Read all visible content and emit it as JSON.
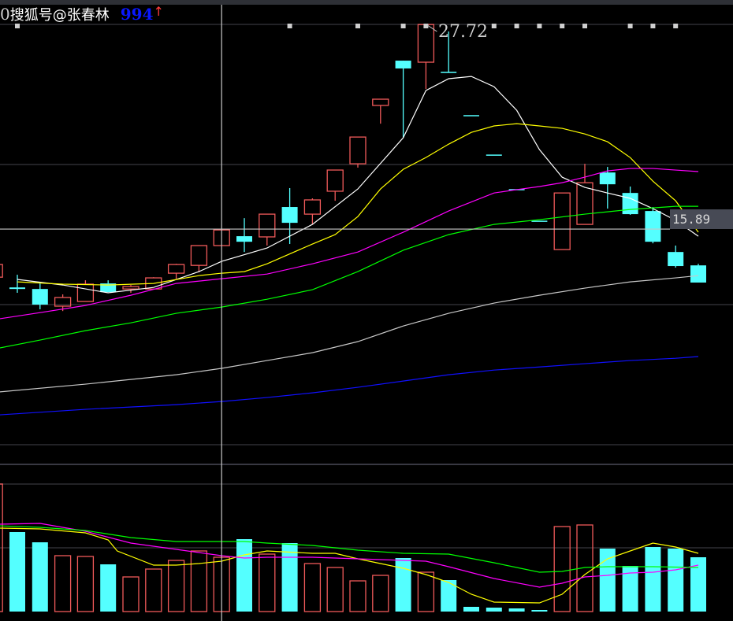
{
  "header": {
    "prefix": "0",
    "watermark": "搜狐号@张春林",
    "code": "994",
    "arrow": "↑"
  },
  "colors": {
    "up": "#f05a5a",
    "down": "#54ffff",
    "ma5": "#ffffff",
    "ma10": "#ffff00",
    "ma20": "#ff00ff",
    "ma30": "#00ff00",
    "ma60": "#c8c8c8",
    "ma120": "#1010ff",
    "crosshair": "#c8c8c8",
    "grid": "#222226",
    "marker": "#cfcfcf",
    "code_color": "#0a18ff"
  },
  "chart_data": {
    "type": "candlestick",
    "title": "",
    "ylim": [
      2.34,
      28.81
    ],
    "volume_ylim": [
      0,
      187
    ],
    "high_label": "27.72",
    "crosshair": {
      "index": 9,
      "price": 15.89,
      "price_label": "15.89"
    },
    "candles": [
      {
        "i": -1,
        "o": 13.12,
        "h": 13.85,
        "l": 13.12,
        "c": 13.85,
        "v": 162
      },
      {
        "i": 0,
        "o": 12.53,
        "h": 13.26,
        "l": 12.22,
        "c": 12.44,
        "v": 101
      },
      {
        "i": 1,
        "o": 12.44,
        "h": 12.76,
        "l": 11.27,
        "c": 11.54,
        "v": 88
      },
      {
        "i": 2,
        "o": 11.45,
        "h": 12.13,
        "l": 11.17,
        "c": 11.95,
        "v": 71
      },
      {
        "i": 3,
        "o": 11.72,
        "h": 12.94,
        "l": 11.72,
        "c": 12.72,
        "v": 70
      },
      {
        "i": 4,
        "o": 12.76,
        "h": 12.94,
        "l": 12.26,
        "c": 12.26,
        "v": 60
      },
      {
        "i": 5,
        "o": 12.44,
        "h": 12.67,
        "l": 12.22,
        "c": 12.58,
        "v": 44
      },
      {
        "i": 6,
        "o": 12.44,
        "h": 13.12,
        "l": 12.44,
        "c": 13.08,
        "v": 54
      },
      {
        "i": 7,
        "o": 13.35,
        "h": 13.89,
        "l": 13.03,
        "c": 13.85,
        "v": 65
      },
      {
        "i": 8,
        "o": 13.8,
        "h": 14.94,
        "l": 13.4,
        "c": 14.94,
        "v": 77
      },
      {
        "i": 9,
        "o": 14.94,
        "h": 15.84,
        "l": 14.94,
        "c": 15.84,
        "v": 69
      },
      {
        "i": 10,
        "o": 15.48,
        "h": 16.52,
        "l": 14.57,
        "c": 15.16,
        "v": 92
      },
      {
        "i": 11,
        "o": 15.44,
        "h": 16.75,
        "l": 14.94,
        "c": 16.75,
        "v": 73
      },
      {
        "i": 12,
        "o": 17.16,
        "h": 18.25,
        "l": 15.03,
        "c": 16.25,
        "v": 87
      },
      {
        "i": 13,
        "o": 16.75,
        "h": 17.66,
        "l": 16.16,
        "c": 17.57,
        "v": 61
      },
      {
        "i": 14,
        "o": 18.07,
        "h": 19.29,
        "l": 17.52,
        "c": 19.29,
        "v": 56
      },
      {
        "i": 15,
        "o": 19.65,
        "h": 21.19,
        "l": 19.43,
        "c": 21.19,
        "v": 39
      },
      {
        "i": 16,
        "o": 23.01,
        "h": 23.37,
        "l": 21.96,
        "c": 23.37,
        "v": 46
      },
      {
        "i": 17,
        "o": 25.59,
        "h": 25.59,
        "l": 21.15,
        "c": 25.14,
        "v": 68
      },
      {
        "i": 18,
        "o": 25.5,
        "h": 27.72,
        "l": 23.96,
        "c": 27.67,
        "v": 50
      },
      {
        "i": 19,
        "o": 24.91,
        "h": 27.27,
        "l": 24.91,
        "c": 24.91,
        "v": 40
      },
      {
        "i": 20,
        "o": 22.42,
        "h": 22.42,
        "l": 22.42,
        "c": 22.42,
        "v": 6
      },
      {
        "i": 21,
        "o": 20.15,
        "h": 20.15,
        "l": 20.15,
        "c": 20.15,
        "v": 5
      },
      {
        "i": 22,
        "o": 18.16,
        "h": 18.16,
        "l": 18.16,
        "c": 18.16,
        "v": 4
      },
      {
        "i": 23,
        "o": 16.34,
        "h": 16.34,
        "l": 16.34,
        "c": 16.34,
        "v": 2
      },
      {
        "i": 24,
        "o": 14.71,
        "h": 17.97,
        "l": 14.71,
        "c": 17.97,
        "v": 108
      },
      {
        "i": 25,
        "o": 16.16,
        "h": 19.65,
        "l": 16.16,
        "c": 18.56,
        "v": 110
      },
      {
        "i": 26,
        "o": 19.15,
        "h": 19.47,
        "l": 17.07,
        "c": 18.47,
        "v": 80
      },
      {
        "i": 27,
        "o": 17.97,
        "h": 18.34,
        "l": 16.71,
        "c": 16.75,
        "v": 58
      },
      {
        "i": 28,
        "o": 16.93,
        "h": 17.16,
        "l": 15.07,
        "c": 15.16,
        "v": 82
      },
      {
        "i": 29,
        "o": 14.57,
        "h": 14.94,
        "l": 13.67,
        "c": 13.76,
        "v": 80
      },
      {
        "i": 30,
        "o": 13.8,
        "h": 13.89,
        "l": 12.81,
        "c": 12.81,
        "v": 69
      }
    ],
    "markers": [
      0,
      12,
      15,
      17,
      18,
      21,
      22,
      23,
      24,
      25,
      27,
      28,
      29
    ],
    "ma_lines": [
      {
        "name": "MA5",
        "color_key": "ma5",
        "points": [
          [
            0,
            12.99
          ],
          [
            2,
            12.67
          ],
          [
            4,
            12.22
          ],
          [
            6,
            12.53
          ],
          [
            8,
            13.44
          ],
          [
            9,
            14.03
          ],
          [
            11,
            14.8
          ],
          [
            13,
            16.16
          ],
          [
            15,
            18.2
          ],
          [
            17,
            21.15
          ],
          [
            18,
            23.87
          ],
          [
            19,
            24.55
          ],
          [
            20,
            24.68
          ],
          [
            21,
            24.09
          ],
          [
            22,
            22.73
          ],
          [
            23,
            20.47
          ],
          [
            24,
            18.88
          ],
          [
            25,
            18.29
          ],
          [
            26,
            17.97
          ],
          [
            27,
            17.66
          ],
          [
            28,
            17.07
          ],
          [
            29,
            16.39
          ],
          [
            30,
            15.48
          ]
        ]
      },
      {
        "name": "MA10",
        "color_key": "ma10",
        "points": [
          [
            0,
            12.85
          ],
          [
            2,
            12.72
          ],
          [
            4,
            12.67
          ],
          [
            6,
            12.76
          ],
          [
            8,
            13.21
          ],
          [
            9,
            13.35
          ],
          [
            10,
            13.44
          ],
          [
            11,
            13.89
          ],
          [
            13,
            15.03
          ],
          [
            14,
            15.57
          ],
          [
            15,
            16.61
          ],
          [
            16,
            18.2
          ],
          [
            17,
            19.33
          ],
          [
            18,
            20.01
          ],
          [
            19,
            20.78
          ],
          [
            20,
            21.46
          ],
          [
            21,
            21.83
          ],
          [
            22,
            21.96
          ],
          [
            23,
            21.83
          ],
          [
            24,
            21.69
          ],
          [
            25,
            21.37
          ],
          [
            26,
            20.92
          ],
          [
            27,
            20.01
          ],
          [
            28,
            18.65
          ],
          [
            29,
            17.52
          ],
          [
            30,
            15.71
          ]
        ]
      },
      {
        "name": "MA20",
        "color_key": "ma20",
        "points": [
          [
            -0.8,
            10.72
          ],
          [
            1,
            11.08
          ],
          [
            3,
            11.49
          ],
          [
            5,
            12.08
          ],
          [
            7,
            12.76
          ],
          [
            9,
            13.03
          ],
          [
            11,
            13.3
          ],
          [
            13,
            13.89
          ],
          [
            15,
            14.57
          ],
          [
            17,
            15.71
          ],
          [
            19,
            16.93
          ],
          [
            21,
            17.97
          ],
          [
            22,
            18.16
          ],
          [
            23,
            18.34
          ],
          [
            24,
            18.56
          ],
          [
            25,
            18.88
          ],
          [
            26,
            19.24
          ],
          [
            27,
            19.38
          ],
          [
            28,
            19.38
          ],
          [
            29,
            19.29
          ],
          [
            30,
            19.2
          ]
        ]
      },
      {
        "name": "MA30",
        "color_key": "ma30",
        "points": [
          [
            -0.8,
            9.04
          ],
          [
            1,
            9.5
          ],
          [
            3,
            10.04
          ],
          [
            5,
            10.49
          ],
          [
            7,
            11.04
          ],
          [
            9,
            11.4
          ],
          [
            11,
            11.85
          ],
          [
            13,
            12.4
          ],
          [
            15,
            13.44
          ],
          [
            17,
            14.67
          ],
          [
            19,
            15.57
          ],
          [
            21,
            16.16
          ],
          [
            23,
            16.43
          ],
          [
            25,
            16.75
          ],
          [
            27,
            17.02
          ],
          [
            29,
            17.2
          ],
          [
            30,
            17.2
          ]
        ]
      },
      {
        "name": "MA60",
        "color_key": "ma60",
        "points": [
          [
            -0.8,
            6.51
          ],
          [
            3,
            6.96
          ],
          [
            7,
            7.5
          ],
          [
            9,
            7.87
          ],
          [
            11,
            8.32
          ],
          [
            13,
            8.77
          ],
          [
            15,
            9.41
          ],
          [
            17,
            10.31
          ],
          [
            19,
            11.04
          ],
          [
            21,
            11.63
          ],
          [
            23,
            12.08
          ],
          [
            25,
            12.49
          ],
          [
            27,
            12.85
          ],
          [
            29,
            13.08
          ],
          [
            30,
            13.21
          ]
        ]
      },
      {
        "name": "MA120",
        "color_key": "ma120",
        "points": [
          [
            -0.8,
            5.19
          ],
          [
            3,
            5.51
          ],
          [
            7,
            5.78
          ],
          [
            9,
            5.96
          ],
          [
            11,
            6.19
          ],
          [
            13,
            6.46
          ],
          [
            15,
            6.78
          ],
          [
            17,
            7.14
          ],
          [
            19,
            7.5
          ],
          [
            21,
            7.77
          ],
          [
            23,
            7.95
          ],
          [
            25,
            8.14
          ],
          [
            27,
            8.32
          ],
          [
            29,
            8.45
          ],
          [
            30,
            8.55
          ]
        ]
      }
    ],
    "volume_ma_lines": [
      {
        "name": "VMA5",
        "color_key": "ma10",
        "points": [
          [
            -0.8,
            106
          ],
          [
            1,
            105
          ],
          [
            3,
            100
          ],
          [
            4,
            91
          ],
          [
            4.4,
            77
          ],
          [
            6,
            59
          ],
          [
            7,
            59
          ],
          [
            8,
            61
          ],
          [
            9,
            64
          ],
          [
            10,
            72
          ],
          [
            11,
            77
          ],
          [
            13,
            74
          ],
          [
            14,
            74
          ],
          [
            15,
            67
          ],
          [
            16,
            61
          ],
          [
            17,
            55
          ],
          [
            18,
            47
          ],
          [
            19,
            37
          ],
          [
            20,
            22
          ],
          [
            21,
            12
          ],
          [
            23,
            11
          ],
          [
            24,
            22
          ],
          [
            25,
            47
          ],
          [
            26,
            67
          ],
          [
            27,
            77
          ],
          [
            28,
            87
          ],
          [
            29,
            82
          ],
          [
            30,
            74
          ]
        ]
      },
      {
        "name": "VMA10",
        "color_key": "ma20",
        "points": [
          [
            -0.8,
            111
          ],
          [
            1,
            112
          ],
          [
            3,
            102
          ],
          [
            5,
            87
          ],
          [
            7,
            79
          ],
          [
            9,
            71
          ],
          [
            10,
            68
          ],
          [
            11,
            69
          ],
          [
            13,
            69
          ],
          [
            15,
            67
          ],
          [
            17,
            65
          ],
          [
            18,
            64
          ],
          [
            19,
            57
          ],
          [
            21,
            42
          ],
          [
            23,
            31
          ],
          [
            24,
            36
          ],
          [
            25,
            44
          ],
          [
            26,
            46
          ],
          [
            27,
            49
          ],
          [
            28,
            50
          ],
          [
            29,
            53
          ],
          [
            30,
            59
          ]
        ]
      },
      {
        "name": "VMA20",
        "color_key": "ma30",
        "points": [
          [
            -0.8,
            109
          ],
          [
            1,
            107
          ],
          [
            3,
            103
          ],
          [
            5,
            94
          ],
          [
            7,
            89
          ],
          [
            9,
            89
          ],
          [
            10,
            89
          ],
          [
            11,
            87
          ],
          [
            13,
            84
          ],
          [
            15,
            78
          ],
          [
            17,
            74
          ],
          [
            19,
            73
          ],
          [
            21,
            62
          ],
          [
            23,
            50
          ],
          [
            24,
            51
          ],
          [
            25,
            56
          ],
          [
            26,
            57
          ],
          [
            27,
            57
          ],
          [
            28,
            57
          ],
          [
            30,
            56
          ]
        ]
      }
    ]
  }
}
